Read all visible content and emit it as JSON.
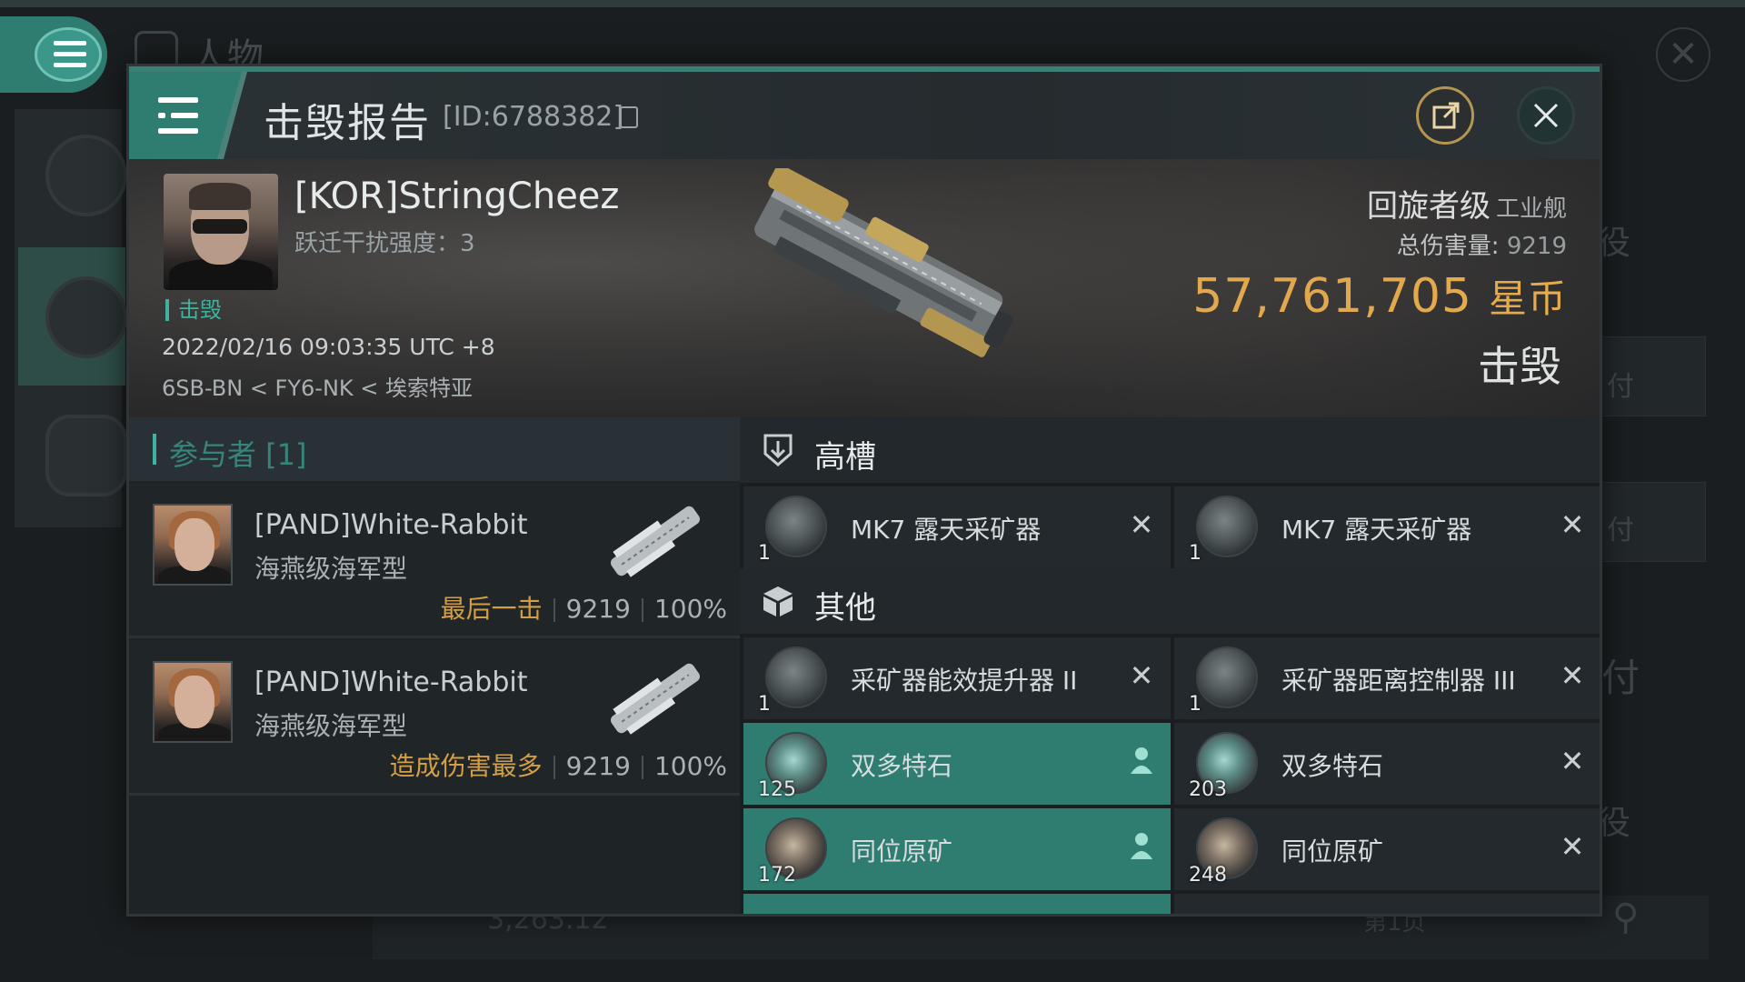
{
  "background": {
    "title": "人物",
    "right_texts": [
      "役",
      "付",
      "付",
      "付",
      "役"
    ],
    "bottom_value": "3,263.12",
    "bottom_page": "第1页"
  },
  "modal": {
    "title": "击毁报告",
    "report_id": "[ID:6788382]",
    "icons": {
      "menu": "menu-icon",
      "copy": "copy-icon",
      "share": "share-icon",
      "close": "close-icon"
    }
  },
  "victim": {
    "name": "[KOR]StringCheez",
    "warp_disruption": "跃迁干扰强度：3",
    "kill_tag": "击毁",
    "time": "2022/02/16 09:03:35 UTC +8",
    "location": "6SB-BN < FY6-NK < 埃索特亚",
    "ship_name": "回旋者级",
    "ship_class": "工业舰",
    "total_damage_label": "总伤害量:",
    "total_damage_value": "9219",
    "isk_value": "57,761,705",
    "isk_unit": "星币",
    "status": "击毁"
  },
  "participants": {
    "header": "参与者 [1]",
    "rows": [
      {
        "name": "[PAND]White-Rabbit",
        "ship": "海燕级海军型",
        "tag": "最后一击",
        "damage": "9219",
        "percent": "100%"
      },
      {
        "name": "[PAND]White-Rabbit",
        "ship": "海燕级海军型",
        "tag": "造成伤害最多",
        "damage": "9219",
        "percent": "100%"
      }
    ]
  },
  "fitting": {
    "high_slots_label": "高槽",
    "other_label": "其他",
    "high_items": [
      {
        "qty": "1",
        "name": "MK7 露天采矿器",
        "action": "✕"
      },
      {
        "qty": "1",
        "name": "MK7 露天采矿器",
        "action": "✕"
      }
    ],
    "other_items": [
      {
        "qty": "1",
        "name": "采矿器能效提升器 II",
        "action": "✕"
      },
      {
        "qty": "1",
        "name": "采矿器距离控制器 III",
        "action": "✕"
      },
      {
        "qty": "125",
        "name": "双多特石",
        "action": "person"
      },
      {
        "qty": "203",
        "name": "双多特石",
        "action": "✕"
      },
      {
        "qty": "172",
        "name": "同位原矿",
        "action": "person"
      },
      {
        "qty": "248",
        "name": "同位原矿",
        "action": "✕"
      }
    ]
  },
  "colors": {
    "accent_teal": "#2f7d71",
    "isk_gold": "#f0b04a",
    "tag_orange": "#d29f46",
    "kill_green": "#3fb39f"
  }
}
